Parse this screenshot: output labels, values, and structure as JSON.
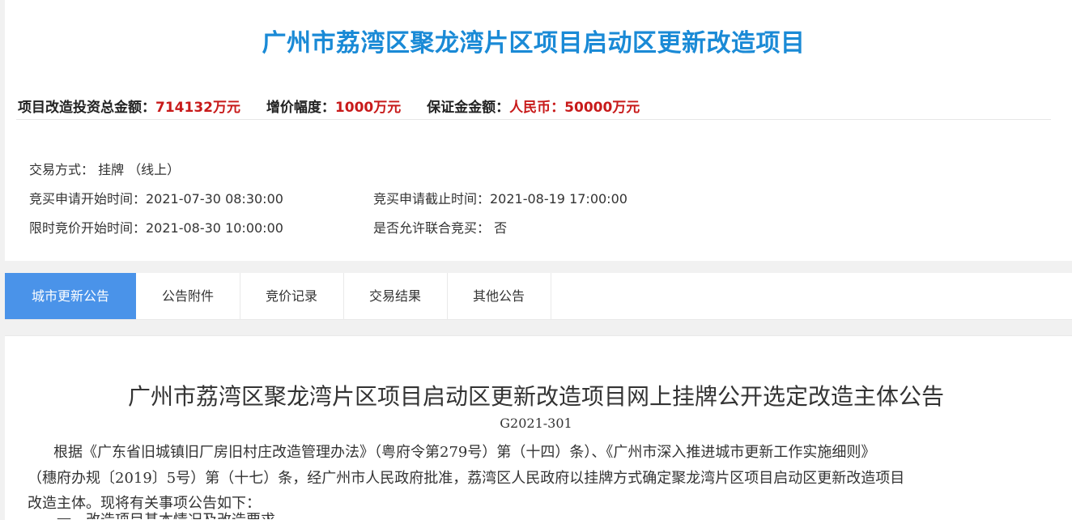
{
  "header": {
    "project_title": "广州市荔湾区聚龙湾片区项目启动区更新改造项目"
  },
  "summary": {
    "investment_label": "项目改造投资总金额：",
    "investment_value": "714132万元",
    "increment_label": "增价幅度：",
    "increment_value": "1000万元",
    "deposit_label": "保证金金额：",
    "deposit_value": "人民币：50000万元"
  },
  "info": {
    "trade_method": "交易方式： 挂牌 （线上）",
    "apply_start": "竞买申请开始时间：2021-07-30 08:30:00",
    "apply_end": "竞买申请截止时间：2021-08-19 17:00:00",
    "bid_start": "限时竞价开始时间：2021-08-30 10:00:00",
    "joint_bid": "是否允许联合竞买： 否"
  },
  "tabs": [
    {
      "label": "城市更新公告"
    },
    {
      "label": "公告附件"
    },
    {
      "label": "竞价记录"
    },
    {
      "label": "交易结果"
    },
    {
      "label": "其他公告"
    }
  ],
  "notice": {
    "title": "广州市荔湾区聚龙湾片区项目启动区更新改造项目网上挂牌公开选定改造主体公告",
    "code": "G2021-301",
    "line1": "根据《广东省旧城镇旧厂房旧村庄改造管理办法》（粤府令第279号）第（十四）条）、《广州市深入推进城市更新工作实施细则》",
    "line2": "（穗府办规〔2019〕5号）第（十七）条，经广州市人民政府批准，荔湾区人民政府以挂牌方式确定聚龙湾片区项目启动区更新改造项目",
    "line3": "改造主体。现将有关事项公告如下：",
    "line4_partial": "一、改造项目基本情况及改造要求"
  },
  "colors": {
    "title_blue": "#1a8ad6",
    "value_red": "#c81a1a",
    "tab_active": "#4a93e9"
  }
}
